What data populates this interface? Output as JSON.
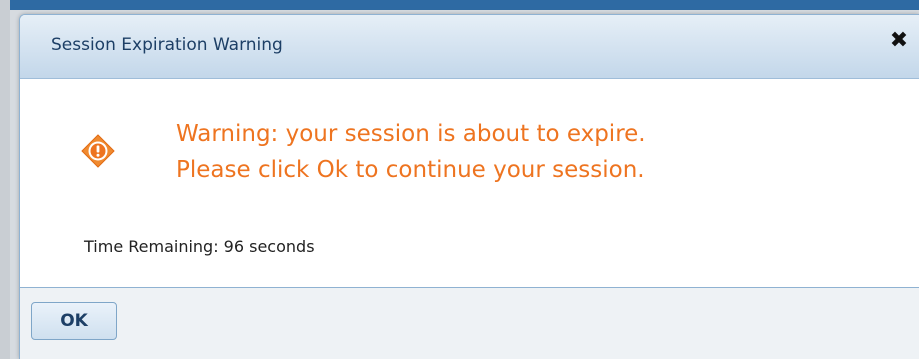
{
  "dialog": {
    "title": "Session Expiration Warning",
    "close_symbol": "✖",
    "warning_line_1": "Warning: your session is about to expire.",
    "warning_line_2": "Please click Ok to continue your session.",
    "time_remaining": "Time Remaining: 96 seconds",
    "ok_label": "OK",
    "icon": "warning-diamond-icon"
  },
  "colors": {
    "warning_text": "#ee7420",
    "title_text": "#1d3f66",
    "border": "#8fb2d2"
  }
}
